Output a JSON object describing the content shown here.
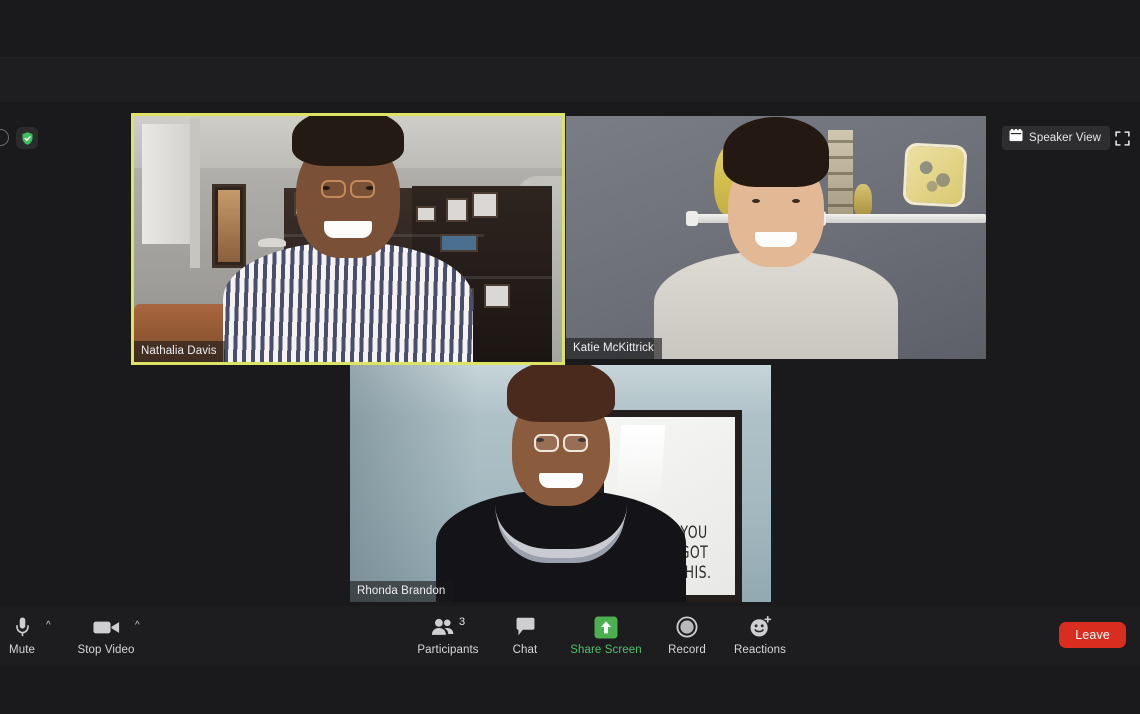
{
  "app": {
    "name": "Zoom Meeting"
  },
  "topbar": {
    "security_icon": "shield-check-icon",
    "view_button": {
      "label": "Speaker View",
      "icon": "grid-view-icon"
    },
    "fullscreen_button": {
      "icon": "fullscreen-expand-icon"
    }
  },
  "participants": [
    {
      "name": "Nathalia Davis",
      "active_speaker": true,
      "active_border_color": "#dde364",
      "scene": "home-office-living-room-with-bookcase-and-framed-art"
    },
    {
      "name": "Katie McKittrick",
      "active_speaker": false,
      "scene": "grey-wall-with-white-floating-shelf-yellow-owl-and-decorative-plate"
    },
    {
      "name": "Rhonda Brandon",
      "active_speaker": false,
      "scene": "light-blue-wall-with-framed-motivational-poster",
      "poster_text": [
        "YOU",
        "GOT",
        "THIS."
      ]
    }
  ],
  "toolbar": {
    "mute": {
      "label": "Mute",
      "icon": "microphone-icon",
      "has_caret": true
    },
    "video": {
      "label": "Stop Video",
      "icon": "video-camera-icon",
      "has_caret": true
    },
    "participants": {
      "label": "Participants",
      "icon": "participants-icon",
      "count": "3"
    },
    "chat": {
      "label": "Chat",
      "icon": "chat-bubble-icon"
    },
    "share": {
      "label": "Share Screen",
      "icon": "share-screen-up-arrow-icon",
      "color": "#4ec16a"
    },
    "record": {
      "label": "Record",
      "icon": "record-circle-icon"
    },
    "reactions": {
      "label": "Reactions",
      "icon": "smiley-reactions-icon"
    },
    "leave": {
      "label": "Leave",
      "color": "#d92d20"
    }
  }
}
